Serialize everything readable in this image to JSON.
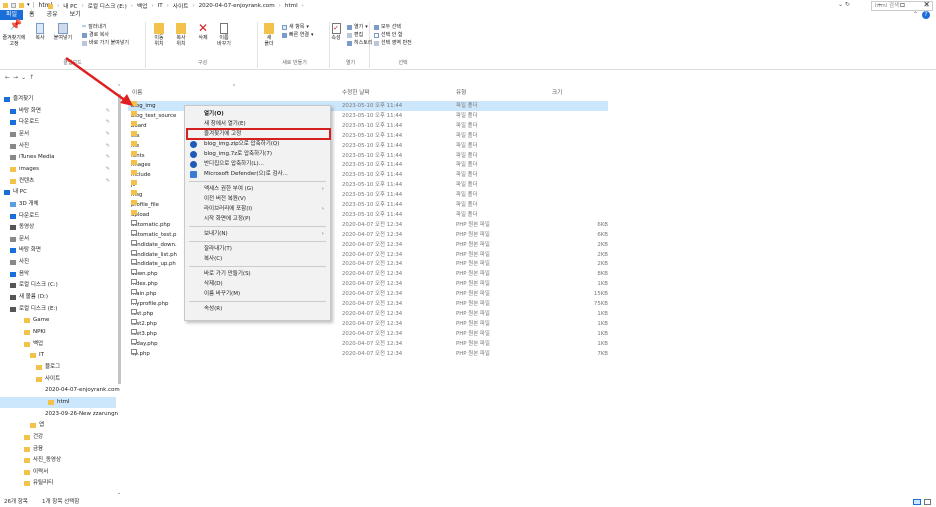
{
  "title": "html",
  "tabs": [
    "파일",
    "홈",
    "공유",
    "보기"
  ],
  "ribbon": {
    "pin_label": "즐겨찾기에\n고정",
    "copy_label": "복사",
    "paste_label": "붙여넣기",
    "cut": "잘라내기",
    "copy_path": "경로 복사",
    "paste_shortcut": "바로 가기 붙여넣기",
    "move_to": "이동\n위치",
    "copy_to": "복사\n위치",
    "delete": "삭제",
    "rename": "이름\n바꾸기",
    "new_folder": "새\n폴더",
    "new_item": "새 항목",
    "easy_access": "빠른 연결",
    "properties": "속성",
    "open": "열기",
    "edit": "편집",
    "history": "히스토리",
    "select_all": "모두 선택",
    "select_none": "선택 안 함",
    "invert": "선택 영역 반전",
    "groups": [
      "클립보드",
      "구성",
      "새로 만들기",
      "열기",
      "선택"
    ]
  },
  "address": {
    "parts": [
      "내 PC",
      "로컬 디스크 (E:)",
      "백업",
      "IT",
      "사이트",
      "2020-04-07-enjoyrank.com",
      "html"
    ],
    "search_placeholder": "html 검색"
  },
  "nav": [
    {
      "label": "즐겨찾기",
      "pin": false
    },
    {
      "label": "바탕 화면",
      "pin": true
    },
    {
      "label": "다운로드",
      "pin": true
    },
    {
      "label": "문서",
      "pin": true
    },
    {
      "label": "사진",
      "pin": true
    },
    {
      "label": "iTunes Media",
      "pin": true
    },
    {
      "label": "images",
      "pin": true
    },
    {
      "label": "컨텐츠",
      "pin": true
    },
    {
      "label": "내 PC",
      "pin": false
    },
    {
      "label": "3D 개체",
      "pin": false
    },
    {
      "label": "다운로드",
      "pin": false
    },
    {
      "label": "동영상",
      "pin": false
    },
    {
      "label": "문서",
      "pin": false
    },
    {
      "label": "바탕 화면",
      "pin": false
    },
    {
      "label": "사진",
      "pin": false
    },
    {
      "label": "음악",
      "pin": false
    },
    {
      "label": "로컬 디스크 (C:)",
      "pin": false
    },
    {
      "label": "새 볼륨 (D:)",
      "pin": false
    },
    {
      "label": "로컬 디스크 (E:)",
      "pin": false
    },
    {
      "label": "Game",
      "pin": false
    },
    {
      "label": "NPKI",
      "pin": false
    },
    {
      "label": "백업",
      "pin": false
    },
    {
      "label": "IT",
      "pin": false
    },
    {
      "label": "블로그",
      "pin": false
    },
    {
      "label": "사이트",
      "pin": false
    },
    {
      "label": "2020-04-07-enjoyrank.com",
      "pin": false
    },
    {
      "label": "html",
      "pin": false
    },
    {
      "label": "2023-09-26-New zzarungn",
      "pin": false
    },
    {
      "label": "앱",
      "pin": false
    },
    {
      "label": "건강",
      "pin": false
    },
    {
      "label": "금융",
      "pin": false
    },
    {
      "label": "사진_동영상",
      "pin": false
    },
    {
      "label": "이력서",
      "pin": false
    },
    {
      "label": "유틸리티",
      "pin": false
    }
  ],
  "columns": {
    "name": "이름",
    "date": "수정한 날짜",
    "type": "유형",
    "size": "크기"
  },
  "files": [
    {
      "name": "blog_img",
      "date": "2023-05-10 오후 11:44",
      "type": "파일 폴더",
      "size": "",
      "folder": true
    },
    {
      "name": "blog_test_source",
      "date": "2023-05-10 오후 11:44",
      "type": "파일 폴더",
      "size": "",
      "folder": true
    },
    {
      "name": "board",
      "date": "2023-05-10 오후 11:44",
      "type": "파일 폴더",
      "size": "",
      "folder": true
    },
    {
      "name": "css",
      "date": "2023-05-10 오후 11:44",
      "type": "파일 폴더",
      "size": "",
      "folder": true
    },
    {
      "name": "file",
      "date": "2023-05-10 오후 11:44",
      "type": "파일 폴더",
      "size": "",
      "folder": true
    },
    {
      "name": "fonts",
      "date": "2023-05-10 오후 11:44",
      "type": "파일 폴더",
      "size": "",
      "folder": true
    },
    {
      "name": "images",
      "date": "2023-05-10 오후 11:44",
      "type": "파일 폴더",
      "size": "",
      "folder": true
    },
    {
      "name": "include",
      "date": "2023-05-10 오후 11:44",
      "type": "파일 폴더",
      "size": "",
      "folder": true
    },
    {
      "name": "js",
      "date": "2023-05-10 오후 11:44",
      "type": "파일 폴더",
      "size": "",
      "folder": true
    },
    {
      "name": "msg",
      "date": "2023-05-10 오후 11:44",
      "type": "파일 폴더",
      "size": "",
      "folder": true
    },
    {
      "name": "profile_file",
      "date": "2023-05-10 오후 11:44",
      "type": "파일 폴더",
      "size": "",
      "folder": true
    },
    {
      "name": "upload",
      "date": "2023-05-10 오후 11:44",
      "type": "파일 폴더",
      "size": "",
      "folder": true
    },
    {
      "name": "automatic.php",
      "date": "2020-04-07 오전 12:34",
      "type": "PHP 원본 파일",
      "size": "6KB",
      "folder": false
    },
    {
      "name": "automatic_test.p",
      "date": "2020-04-07 오전 12:34",
      "type": "PHP 원본 파일",
      "size": "6KB",
      "folder": false
    },
    {
      "name": "candidate_down.",
      "date": "2020-04-07 오전 12:34",
      "type": "PHP 원본 파일",
      "size": "2KB",
      "folder": false
    },
    {
      "name": "candidate_list.ph",
      "date": "2020-04-07 오전 12:34",
      "type": "PHP 원본 파일",
      "size": "2KB",
      "folder": false
    },
    {
      "name": "candidate_up.ph",
      "date": "2020-04-07 오전 12:34",
      "type": "PHP 원본 파일",
      "size": "2KB",
      "folder": false
    },
    {
      "name": "down.php",
      "date": "2020-04-07 오전 12:34",
      "type": "PHP 원본 파일",
      "size": "8KB",
      "folder": false
    },
    {
      "name": "index.php",
      "date": "2020-04-07 오전 12:34",
      "type": "PHP 원본 파일",
      "size": "1KB",
      "folder": false
    },
    {
      "name": "main.php",
      "date": "2020-04-07 오전 12:34",
      "type": "PHP 원본 파일",
      "size": "15KB",
      "folder": false
    },
    {
      "name": "myprofile.php",
      "date": "2020-04-07 오전 12:34",
      "type": "PHP 원본 파일",
      "size": "75KB",
      "folder": false
    },
    {
      "name": "test.php",
      "date": "2020-04-07 오전 12:34",
      "type": "PHP 원본 파일",
      "size": "1KB",
      "folder": false
    },
    {
      "name": "test2.php",
      "date": "2020-04-07 오전 12:34",
      "type": "PHP 원본 파일",
      "size": "1KB",
      "folder": false
    },
    {
      "name": "test3.php",
      "date": "2020-04-07 오전 12:34",
      "type": "PHP 원본 파일",
      "size": "1KB",
      "folder": false
    },
    {
      "name": "today.php",
      "date": "2020-04-07 오전 12:34",
      "type": "PHP 원본 파일",
      "size": "1KB",
      "folder": false
    },
    {
      "name": "up.php",
      "date": "2020-04-07 오전 12:34",
      "type": "PHP 원본 파일",
      "size": "7KB",
      "folder": false
    }
  ],
  "context_menu": [
    {
      "label": "열기(O)",
      "bold": true,
      "icon": "",
      "sub": false
    },
    {
      "label": "새 창에서 열기(E)",
      "bold": false,
      "icon": "",
      "sub": false
    },
    {
      "label": "즐겨찾기에 고정",
      "bold": false,
      "icon": "",
      "sub": false
    },
    {
      "label": "blog_img.zip으로 압축하기(Q)",
      "bold": false,
      "icon": "bandizip-icon",
      "sub": false
    },
    {
      "label": "blog_img.7z로 압축하기(7)",
      "bold": false,
      "icon": "bandizip-icon",
      "sub": false
    },
    {
      "label": "반디집으로 압축하기(L)...",
      "bold": false,
      "icon": "bandizip-icon",
      "sub": false
    },
    {
      "label": "Microsoft Defender(으)로 검사...",
      "bold": false,
      "icon": "defender-icon",
      "sub": false
    },
    {
      "sep": true
    },
    {
      "label": "액세스 권한 부여 (G)",
      "bold": false,
      "icon": "",
      "sub": true
    },
    {
      "label": "이전 버전 복원(V)",
      "bold": false,
      "icon": "",
      "sub": false
    },
    {
      "label": "라이브러리에 포함(I)",
      "bold": false,
      "icon": "",
      "sub": true
    },
    {
      "label": "시작 화면에 고정(P)",
      "bold": false,
      "icon": "",
      "sub": false
    },
    {
      "sep": true
    },
    {
      "label": "보내기(N)",
      "bold": false,
      "icon": "",
      "sub": true
    },
    {
      "sep": true
    },
    {
      "label": "잘라내기(T)",
      "bold": false,
      "icon": "",
      "sub": false
    },
    {
      "label": "복사(C)",
      "bold": false,
      "icon": "",
      "sub": false
    },
    {
      "sep": true
    },
    {
      "label": "바로 가기 만들기(S)",
      "bold": false,
      "icon": "",
      "sub": false
    },
    {
      "label": "삭제(D)",
      "bold": false,
      "icon": "",
      "sub": false
    },
    {
      "label": "이름 바꾸기(M)",
      "bold": false,
      "icon": "",
      "sub": false
    },
    {
      "sep": true
    },
    {
      "label": "속성(R)",
      "bold": false,
      "icon": "",
      "sub": false
    }
  ],
  "status": {
    "count": "26개 항목",
    "selected": "1개 항목 선택함"
  },
  "colors": {
    "accent": "#1a6ed8",
    "folder": "#f2c24b",
    "selection": "#cce6fb",
    "highlight": "#d42020"
  }
}
